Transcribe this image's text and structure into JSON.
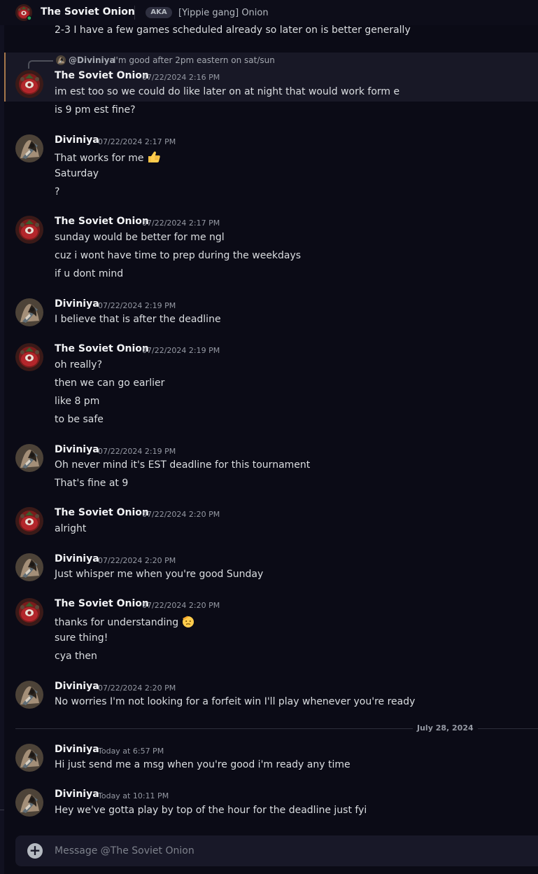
{
  "header": {
    "title": "The Soviet Onion",
    "aka_badge": "AKA",
    "aka_value": "[Yippie gang] Onion"
  },
  "partial_line": "2-3 I have a few games scheduled already so later on is better generally",
  "reply": {
    "author": "@Diviniya",
    "text": "I'm good after 2pm eastern on sat/sun"
  },
  "messages": [
    {
      "author": "The Soviet Onion",
      "timestamp": "07/22/2024 2:16 PM",
      "lines": [
        "im est too so we could do like later on at night that would work form e",
        "is 9 pm est fine?"
      ]
    },
    {
      "author": "Diviniya",
      "timestamp": "07/22/2024 2:17 PM",
      "lines": [
        "That works for me",
        "Saturday",
        "?"
      ],
      "emoji_after_line_1": "thumbs-up"
    },
    {
      "author": "The Soviet Onion",
      "timestamp": "07/22/2024 2:17 PM",
      "lines": [
        "sunday would be better for me ngl",
        "cuz i wont have time to prep during the weekdays",
        "if u dont mind"
      ]
    },
    {
      "author": "Diviniya",
      "timestamp": "07/22/2024 2:19 PM",
      "lines": [
        "I believe that is after the deadline"
      ]
    },
    {
      "author": "The Soviet Onion",
      "timestamp": "07/22/2024 2:19 PM",
      "lines": [
        "oh really?",
        "then we can go earlier",
        "like 8 pm",
        "to be safe"
      ]
    },
    {
      "author": "Diviniya",
      "timestamp": "07/22/2024 2:19 PM",
      "lines": [
        "Oh never mind it's EST deadline for this tournament",
        "That's fine at 9"
      ]
    },
    {
      "author": "The Soviet Onion",
      "timestamp": "07/22/2024 2:20 PM",
      "lines": [
        "alright"
      ]
    },
    {
      "author": "Diviniya",
      "timestamp": "07/22/2024 2:20 PM",
      "lines": [
        "Just whisper me when you're good Sunday"
      ]
    },
    {
      "author": "The Soviet Onion",
      "timestamp": "07/22/2024 2:20 PM",
      "lines": [
        "thanks for understanding",
        "sure thing!",
        "cya then"
      ],
      "emoji_after_line_1": "saluting-face"
    },
    {
      "author": "Diviniya",
      "timestamp": "07/22/2024 2:20 PM",
      "lines": [
        "No worries I'm not looking for a forfeit win I'll play whenever you're ready"
      ]
    },
    {
      "author": "Diviniya",
      "timestamp": "Today at 6:57 PM",
      "lines": [
        "Hi just send me a msg when you're good i'm ready any time"
      ]
    },
    {
      "author": "Diviniya",
      "timestamp": "Today at 10:11 PM",
      "lines": [
        "Hey we've gotta play by top of the hour for the deadline just fyi"
      ]
    }
  ],
  "date_divider": "July 28, 2024",
  "composer": {
    "placeholder": "Message @The Soviet Onion"
  },
  "colors": {
    "background": "#0b0b16",
    "highlight_border": "#a6774b",
    "highlight_background": "#181826",
    "composer_background": "#181828"
  }
}
